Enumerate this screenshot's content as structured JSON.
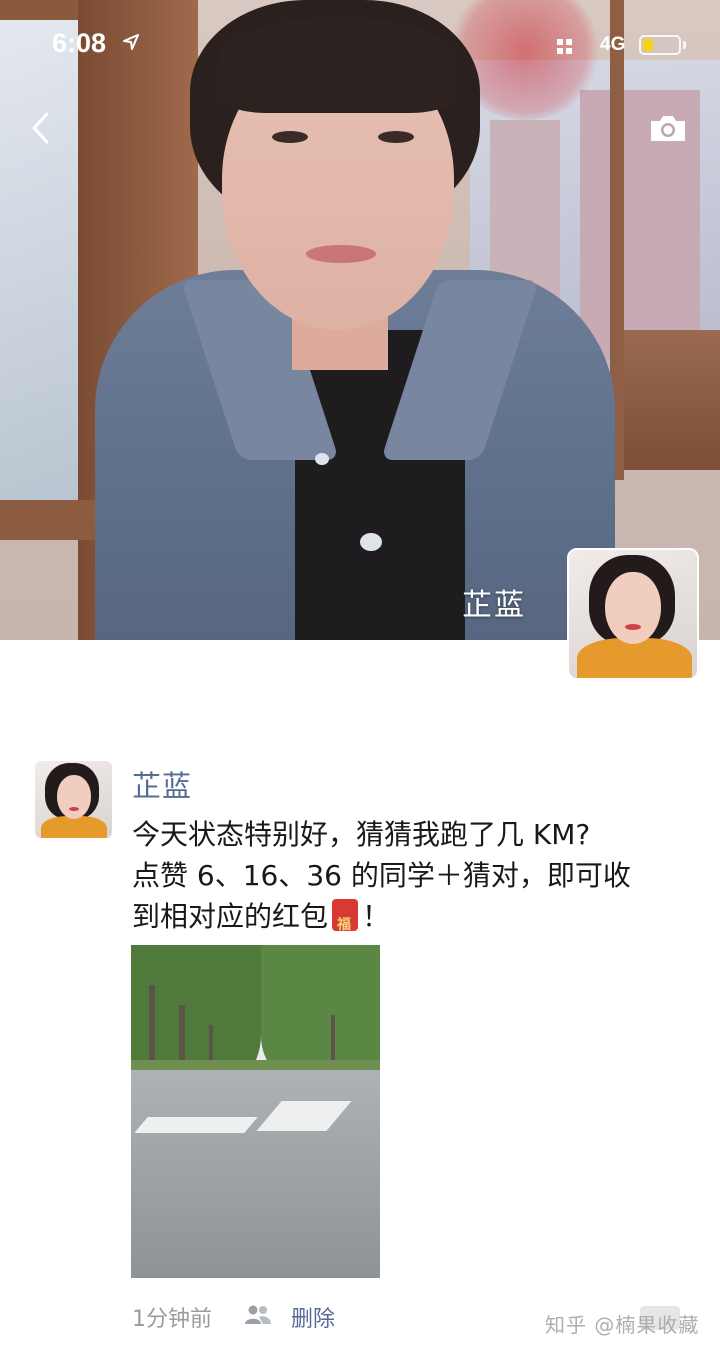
{
  "status_bar": {
    "time": "6:08",
    "network": "4G",
    "battery_level": 0.3,
    "battery_color": "#f7d117"
  },
  "header": {
    "back_icon": "chevron-left-icon",
    "camera_icon": "camera-icon",
    "cover_name": "芷蓝"
  },
  "post": {
    "author": "芷蓝",
    "text_line1": "今天状态特别好，猜猜我跑了几 KM?",
    "text_line2": "点赞 6、16、36 的同学＋猜对，即可收",
    "text_line3_before": "到相对应的红包",
    "text_line3_after": "！",
    "time": "1分钟前",
    "delete_label": "删除",
    "link_color": "#576b95"
  },
  "watermark": "知乎 @楠果收藏"
}
